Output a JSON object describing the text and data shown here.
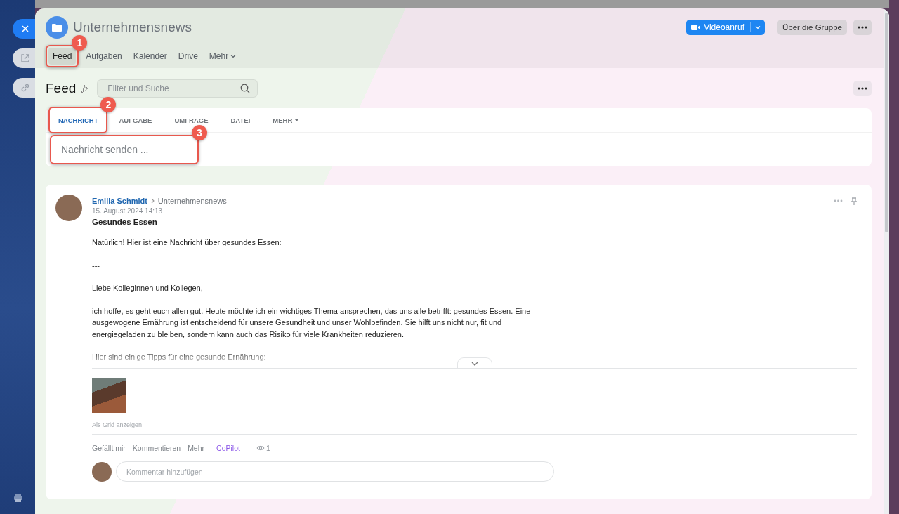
{
  "group": {
    "title": "Unternehmensnews",
    "nav": [
      {
        "label": "Feed",
        "selected": true,
        "dropdown": false,
        "callout": "1"
      },
      {
        "label": "Aufgaben",
        "selected": false,
        "dropdown": false
      },
      {
        "label": "Kalender",
        "selected": false,
        "dropdown": false
      },
      {
        "label": "Drive",
        "selected": false,
        "dropdown": false
      },
      {
        "label": "Mehr",
        "selected": false,
        "dropdown": true
      }
    ],
    "video_call_button": "Videoanruf",
    "about_button": "Über die Gruppe"
  },
  "feed": {
    "title": "Feed",
    "search": {
      "placeholder": "Filter und Suche"
    }
  },
  "composer": {
    "tabs": [
      {
        "label": "NACHRICHT",
        "selected": true,
        "dropdown": false,
        "callout": "2"
      },
      {
        "label": "AUFGABE",
        "selected": false,
        "dropdown": false
      },
      {
        "label": "UMFRAGE",
        "selected": false,
        "dropdown": false
      },
      {
        "label": "DATEI",
        "selected": false,
        "dropdown": false
      },
      {
        "label": "MEHR",
        "selected": false,
        "dropdown": true
      }
    ],
    "message_field": {
      "placeholder": "Nachricht senden ...",
      "callout": "3"
    }
  },
  "post": {
    "author": "Emilia Schmidt",
    "group": "Unternehmensnews",
    "date": "15. August 2024 14:13",
    "title": "Gesundes Essen",
    "paragraphs": [
      "Natürlich! Hier ist eine Nachricht über gesundes Essen:",
      "---",
      "Liebe Kolleginnen und Kollegen,",
      "ich hoffe, es geht euch allen gut. Heute möchte ich ein wichtiges Thema ansprechen, das uns alle betrifft: gesundes Essen. Eine ausgewogene Ernährung ist entscheidend für unsere Gesundheit und unser Wohlbefinden. Sie hilft uns nicht nur, fit und energiegeladen zu bleiben, sondern kann auch das Risiko für viele Krankheiten reduzieren.",
      "Hier sind einige Tipps für eine gesunde Ernährung:"
    ],
    "image_caption": "Als Grid anzeigen",
    "actions": [
      {
        "label": "Gefällt mir",
        "kind": "plain"
      },
      {
        "label": "Kommentieren",
        "kind": "plain"
      },
      {
        "label": "Mehr",
        "kind": "plain"
      },
      {
        "label": "CoPilot",
        "kind": "ai"
      }
    ],
    "views": "1",
    "comment": {
      "placeholder": "Kommentar hinzufügen"
    }
  }
}
